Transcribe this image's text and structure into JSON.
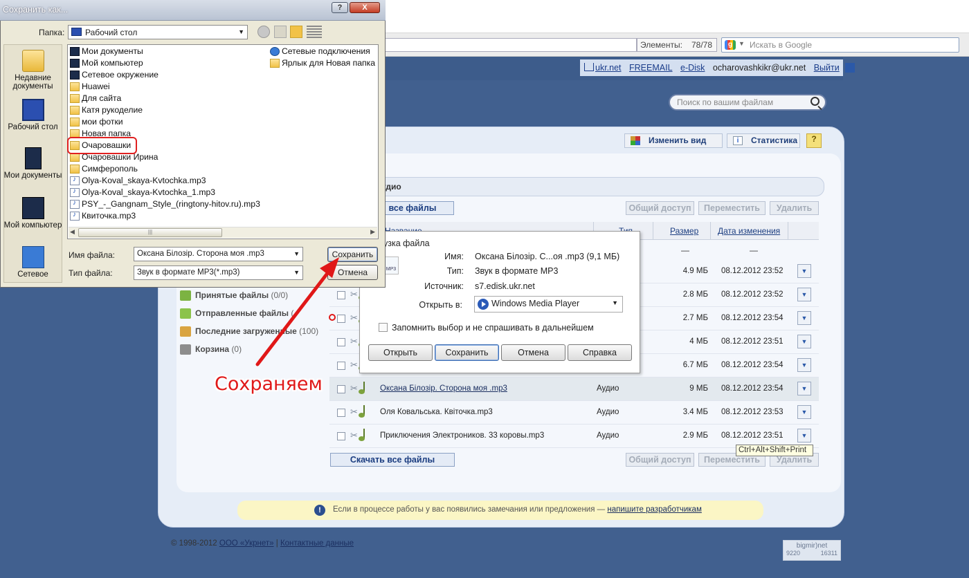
{
  "browser": {
    "elements_label": "Элементы:",
    "elements_count": "78/78",
    "google_search_placeholder": "Искать в Google"
  },
  "topnav": {
    "home_link": "ukr.net",
    "freemail_link": "FREEMAIL",
    "edisk_link": "e-Disk",
    "user_email": "ocharovashkikr@ukr.net",
    "logout_link": "Выйти"
  },
  "file_search_placeholder": "Поиск по вашим файлам",
  "toolbar": {
    "change_view": "Изменить вид",
    "statistics": "Статистика",
    "help": "?"
  },
  "folder_title": "удио",
  "actions": {
    "download_all_top": "все файлы",
    "download_all_bottom": "Скачать все файлы",
    "share": "Общий доступ",
    "move": "Переместить",
    "delete": "Удалить"
  },
  "table": {
    "columns": {
      "name": "Название",
      "type": "Тип",
      "size": "Размер",
      "date": "Дата изменения"
    },
    "parent_row": {
      "size": "—",
      "date": "—"
    },
    "rows": [
      {
        "name": "",
        "type": "",
        "size": "4.9 МБ",
        "date": "08.12.2012 23:52"
      },
      {
        "name": "",
        "type": "",
        "size": "2.8 МБ",
        "date": "08.12.2012 23:52"
      },
      {
        "name": "",
        "type": "",
        "size": "2.7 МБ",
        "date": "08.12.2012 23:54"
      },
      {
        "name": "",
        "type": "",
        "size": "4 МБ",
        "date": "08.12.2012 23:51"
      },
      {
        "name": "",
        "type": "",
        "size": "6.7 МБ",
        "date": "08.12.2012 23:54"
      },
      {
        "name": "Оксана Білозір. Сторона моя .mp3",
        "type": "Аудио",
        "size": "9 МБ",
        "date": "08.12.2012 23:54"
      },
      {
        "name": "Оля Ковальська. Квіточка.mp3",
        "type": "Аудио",
        "size": "3.4 МБ",
        "date": "08.12.2012 23:53"
      },
      {
        "name": "Приключения Электроников. 33 коровы.mp3",
        "type": "Аудио",
        "size": "2.9 МБ",
        "date": "08.12.2012 23:51"
      }
    ]
  },
  "left_nav": [
    {
      "label": "Принятые файлы",
      "count": "(0/0)"
    },
    {
      "label": "Отправленные файлы",
      "count": "("
    },
    {
      "label": "Последние загруженные",
      "count": "(100)"
    },
    {
      "label": "Корзина",
      "count": "(0)"
    }
  ],
  "tooltip": "Ctrl+Alt+Shift+Print",
  "infobar": {
    "text": "Если в процессе работы у вас появились замечания или предложения — ",
    "link": "напишите разработчикам"
  },
  "footer": {
    "copyright": "© 1998-2012",
    "company_link": "ООО «Укрнет»",
    "contacts_link": "Контактные данные"
  },
  "counter": {
    "brand": "bigmir)net",
    "left": "9220",
    "right": "16311"
  },
  "download_dialog": {
    "title": "узка файла",
    "name_label": "Имя:",
    "name_value": "Оксана Білозір. С...оя .mp3 (9,1 МБ)",
    "type_label": "Тип:",
    "type_value": "Звук в формате MP3",
    "source_label": "Источник:",
    "source_value": "s7.edisk.ukr.net",
    "open_with_label": "Открыть в:",
    "open_with_value": "Windows Media Player",
    "remember_label": "Запомнить выбор и не спрашивать в дальнейшем",
    "buttons": {
      "open": "Открыть",
      "save": "Сохранить",
      "cancel": "Отмена",
      "help": "Справка"
    }
  },
  "save_dialog": {
    "title": "Сохранить как...",
    "help_btn": "?",
    "close_btn": "X",
    "folder_label": "Папка:",
    "folder_value": "Рабочий стол",
    "places": [
      "Недавние документы",
      "Рабочий стол",
      "Мои документы",
      "Мой компьютер",
      "Сетевое"
    ],
    "files_col1": [
      {
        "name": "Мои документы",
        "icon": "system"
      },
      {
        "name": "Мой компьютер",
        "icon": "system"
      },
      {
        "name": "Сетевое окружение",
        "icon": "system"
      },
      {
        "name": "Huawei",
        "icon": "folder"
      },
      {
        "name": "Для сайта",
        "icon": "folder"
      },
      {
        "name": "Катя рукоделие",
        "icon": "folder"
      },
      {
        "name": "мои фотки",
        "icon": "folder"
      },
      {
        "name": "Новая папка",
        "icon": "folder"
      },
      {
        "name": "Очаровашки",
        "icon": "folder"
      },
      {
        "name": "Очаровашки Ирина",
        "icon": "folder"
      },
      {
        "name": "Симферополь",
        "icon": "folder"
      },
      {
        "name": "Olya-Koval_skaya-Kvtochka.mp3",
        "icon": "mp3"
      },
      {
        "name": "Olya-Koval_skaya-Kvtochka_1.mp3",
        "icon": "mp3"
      },
      {
        "name": "PSY_-_Gangnam_Style_(ringtony-hitov.ru).mp3",
        "icon": "mp3"
      },
      {
        "name": "Квиточка.mp3",
        "icon": "mp3"
      }
    ],
    "files_col2": [
      {
        "name": "Сетевые подключения",
        "icon": "network"
      },
      {
        "name": "Ярлык для Новая папка",
        "icon": "folder"
      }
    ],
    "filename_label": "Имя файла:",
    "filename_value": "Оксана Білозір. Сторона моя .mp3",
    "filetype_label": "Тип файла:",
    "filetype_value": "Звук в формате MP3(*.mp3)",
    "save_btn": "Сохранить",
    "cancel_btn": "Отмена"
  },
  "annotation": {
    "caption": "Сохраняем",
    "color": "#e01818"
  }
}
